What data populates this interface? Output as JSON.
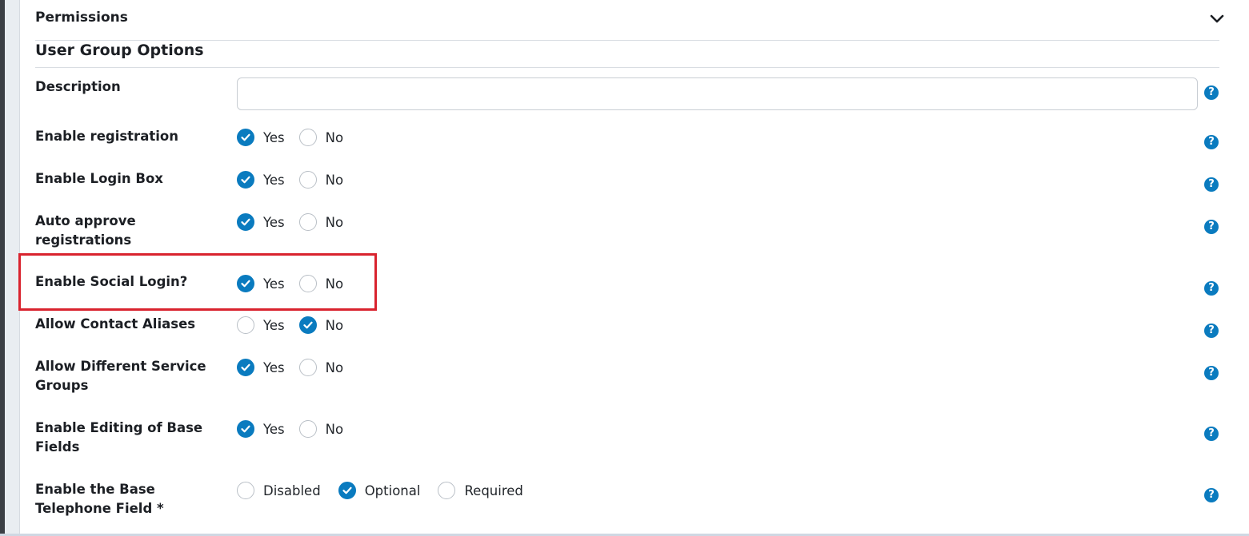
{
  "accordion": {
    "title": "Permissions"
  },
  "section": {
    "title": "User Group Options"
  },
  "description": {
    "label": "Description",
    "value": "",
    "placeholder": ""
  },
  "help": {
    "glyph": "?"
  },
  "accent_color": "#0a7bbf",
  "highlight_color": "#d9232e",
  "rows": [
    {
      "label": "Enable registration",
      "options": [
        {
          "text": "Yes",
          "checked": true
        },
        {
          "text": "No",
          "checked": false
        }
      ]
    },
    {
      "label": "Enable Login Box",
      "options": [
        {
          "text": "Yes",
          "checked": true
        },
        {
          "text": "No",
          "checked": false
        }
      ]
    },
    {
      "label": "Auto approve registrations",
      "options": [
        {
          "text": "Yes",
          "checked": true
        },
        {
          "text": "No",
          "checked": false
        }
      ]
    },
    {
      "label": "Enable Social Login?",
      "options": [
        {
          "text": "Yes",
          "checked": true
        },
        {
          "text": "No",
          "checked": false
        }
      ]
    },
    {
      "label": "Allow Contact Aliases",
      "options": [
        {
          "text": "Yes",
          "checked": false
        },
        {
          "text": "No",
          "checked": true
        }
      ]
    },
    {
      "label": "Allow Different Service Groups",
      "options": [
        {
          "text": "Yes",
          "checked": true
        },
        {
          "text": "No",
          "checked": false
        }
      ]
    },
    {
      "label": "Enable Editing of Base Fields",
      "options": [
        {
          "text": "Yes",
          "checked": true
        },
        {
          "text": "No",
          "checked": false
        }
      ]
    },
    {
      "label": "Enable the Base Telephone Field *",
      "options": [
        {
          "text": "Disabled",
          "checked": false
        },
        {
          "text": "Optional",
          "checked": true
        },
        {
          "text": "Required",
          "checked": false
        }
      ]
    }
  ]
}
